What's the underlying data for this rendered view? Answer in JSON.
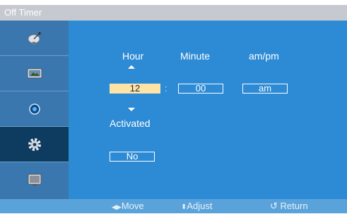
{
  "title": "Off Timer",
  "sidebar": {
    "items": [
      {
        "icon": "satellite-dish-icon"
      },
      {
        "icon": "picture-icon"
      },
      {
        "icon": "sound-icon"
      },
      {
        "icon": "gear-icon",
        "selected": true
      },
      {
        "icon": "multi-screen-icon"
      }
    ]
  },
  "timer": {
    "hour_label": "Hour",
    "minute_label": "Minute",
    "ampm_label": "am/pm",
    "hour_value": "12",
    "separator": ":",
    "minute_value": "00",
    "ampm_value": "am",
    "activated_label": "Activated",
    "activated_value": "No"
  },
  "footer": {
    "move": "Move",
    "adjust": "Adjust",
    "return": "Return"
  },
  "colors": {
    "title_bar": "#c7c9d1",
    "sidebar": "#3a77ae",
    "sidebar_selected": "#0e3b60",
    "main_panel": "#2d8ad4",
    "footer": "#5aa3da",
    "active_field": "#fde3a6"
  }
}
